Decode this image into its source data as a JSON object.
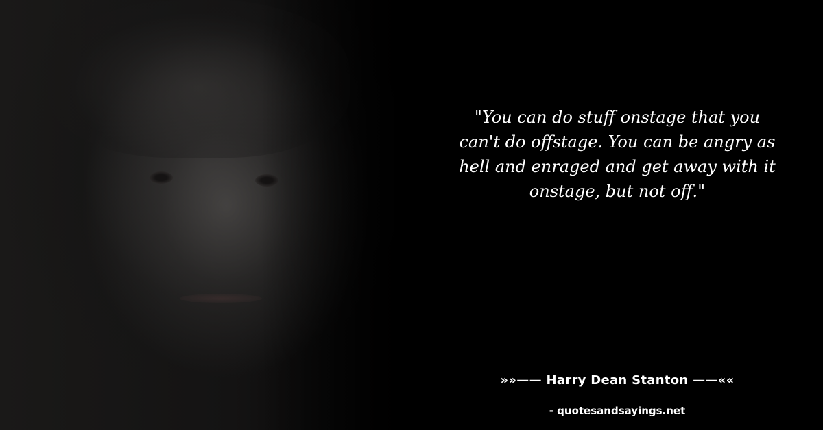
{
  "quote": {
    "text": "\"You can do stuff onstage that you can't do offstage. You can be angry as hell and enraged and get away with it onstage, but not off.\""
  },
  "author": {
    "line": "»»—— Harry Dean Stanton ——««"
  },
  "source": {
    "line": "- quotesandsayings.net"
  },
  "colors": {
    "background": "#000000",
    "text": "#ffffff"
  }
}
